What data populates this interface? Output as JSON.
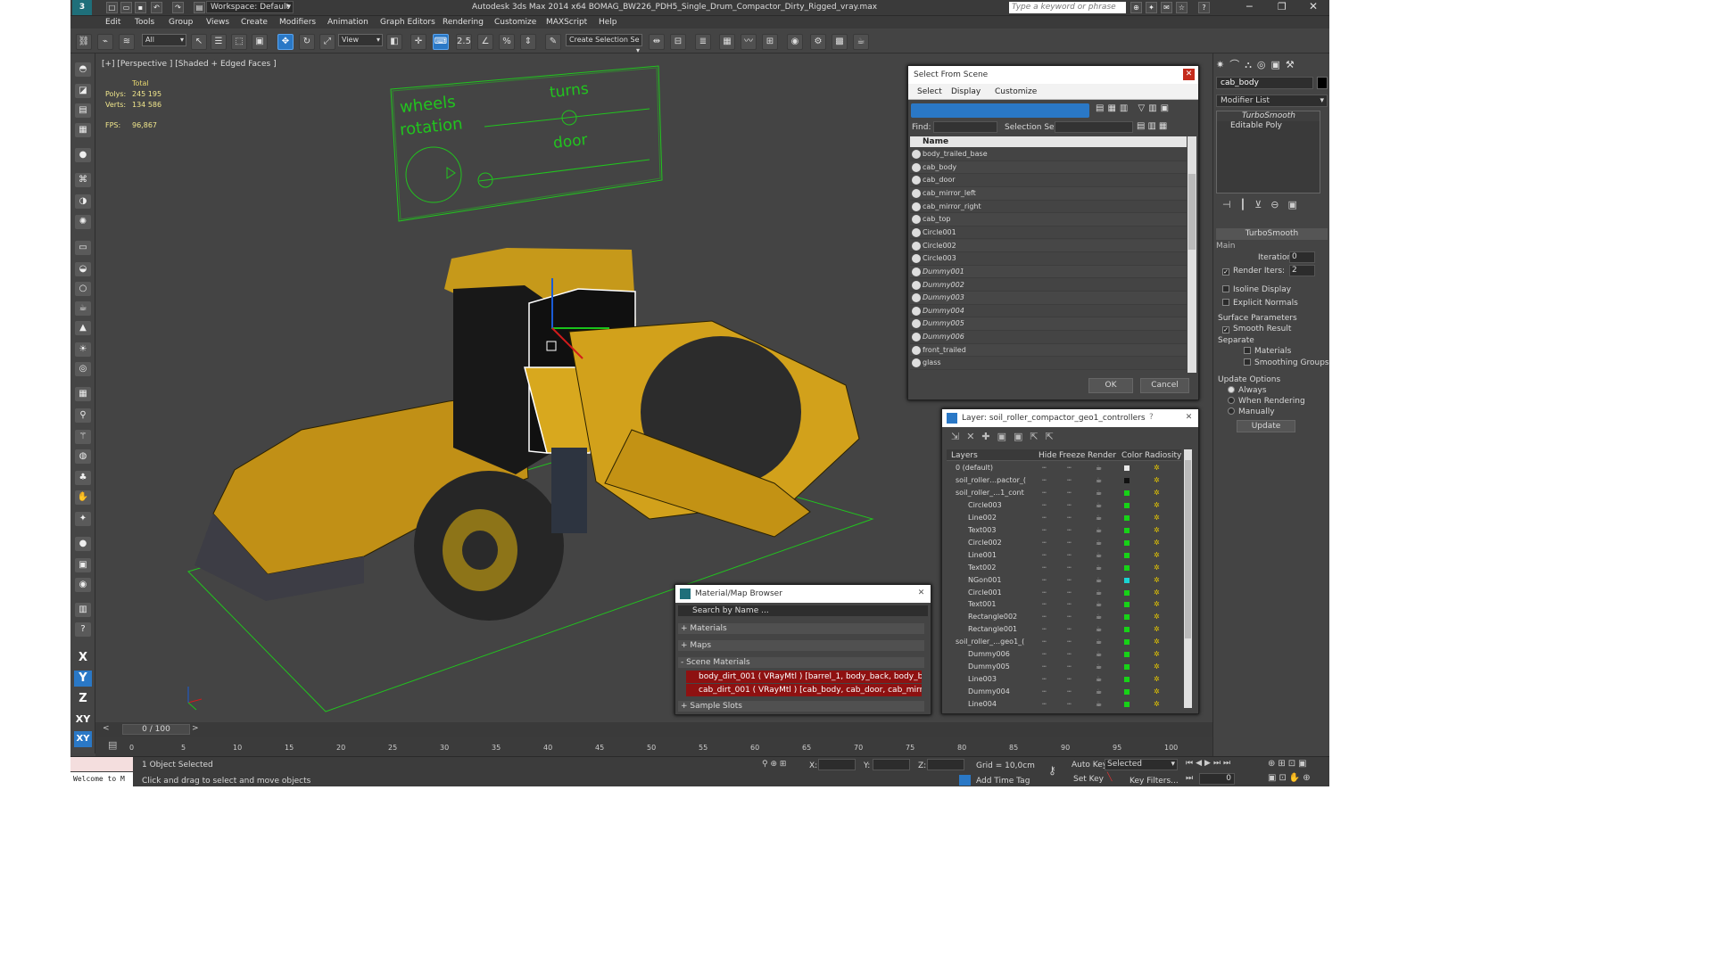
{
  "app": {
    "workspace": "Workspace: Default",
    "title": "Autodesk 3ds Max  2014 x64     BOMAG_BW226_PDH5_Single_Drum_Compactor_Dirty_Rigged_vray.max",
    "search_placeholder": "Type a keyword or phrase"
  },
  "menu": [
    "Edit",
    "Tools",
    "Group",
    "Views",
    "Create",
    "Modifiers",
    "Animation",
    "Graph Editors",
    "Rendering",
    "Customize",
    "MAXScript",
    "Help"
  ],
  "toolbar": {
    "filter": "All",
    "coord": "View",
    "snap_angle": "2.5",
    "snap_pct": "%",
    "selection_set": "Create Selection Se"
  },
  "viewport": {
    "label": "[+] [Perspective ] [Shaded + Edged Faces ]",
    "stats": {
      "total": "Total",
      "polys_label": "Polys:",
      "polys": "245 195",
      "verts_label": "Verts:",
      "verts": "134 586",
      "fps_label": "FPS:",
      "fps": "96,867"
    },
    "control_panel": {
      "wheels": "wheels",
      "rotation": "rotation",
      "turns": "turns",
      "door": "door"
    }
  },
  "select_scene": {
    "title": "Select From Scene",
    "menu": [
      "Select",
      "Display",
      "Customize"
    ],
    "find_label": "Find:",
    "sel_set_label": "Selection Set:",
    "col_name": "Name",
    "items": [
      {
        "name": "body_trailed_base",
        "italic": false
      },
      {
        "name": "cab_body",
        "italic": false
      },
      {
        "name": "cab_door",
        "italic": false
      },
      {
        "name": "cab_mirror_left",
        "italic": false
      },
      {
        "name": "cab_mirror_right",
        "italic": false
      },
      {
        "name": "cab_top",
        "italic": false
      },
      {
        "name": "Circle001",
        "italic": false
      },
      {
        "name": "Circle002",
        "italic": false
      },
      {
        "name": "Circle003",
        "italic": false
      },
      {
        "name": "Dummy001",
        "italic": true
      },
      {
        "name": "Dummy002",
        "italic": true
      },
      {
        "name": "Dummy003",
        "italic": true
      },
      {
        "name": "Dummy004",
        "italic": true
      },
      {
        "name": "Dummy005",
        "italic": true
      },
      {
        "name": "Dummy006",
        "italic": true
      },
      {
        "name": "front_trailed",
        "italic": false
      },
      {
        "name": "glass",
        "italic": false
      }
    ],
    "ok": "OK",
    "cancel": "Cancel"
  },
  "layer": {
    "title": "Layer: soil_roller_compactor_geo1_controllers",
    "help": "?",
    "cols": [
      "Layers",
      "Hide",
      "Freeze",
      "Render",
      "Color",
      "Radiosity"
    ],
    "rows": [
      {
        "name": "0 (default)",
        "indent": 0,
        "color": "#e8e8e8"
      },
      {
        "name": "soil_roller…pactor_(",
        "indent": 0,
        "color": "#111111"
      },
      {
        "name": "soil_roller_…1_cont",
        "indent": 0,
        "color": "#17d317"
      },
      {
        "name": "Circle003",
        "indent": 1,
        "color": "#17d317"
      },
      {
        "name": "Line002",
        "indent": 1,
        "color": "#17d317"
      },
      {
        "name": "Text003",
        "indent": 1,
        "color": "#17d317"
      },
      {
        "name": "Circle002",
        "indent": 1,
        "color": "#17d317"
      },
      {
        "name": "Line001",
        "indent": 1,
        "color": "#17d317"
      },
      {
        "name": "Text002",
        "indent": 1,
        "color": "#17d317"
      },
      {
        "name": "NGon001",
        "indent": 1,
        "color": "#1ad4d4"
      },
      {
        "name": "Circle001",
        "indent": 1,
        "color": "#17d317"
      },
      {
        "name": "Text001",
        "indent": 1,
        "color": "#17d317"
      },
      {
        "name": "Rectangle002",
        "indent": 1,
        "color": "#17d317"
      },
      {
        "name": "Rectangle001",
        "indent": 1,
        "color": "#17d317"
      },
      {
        "name": "soil_roller_…geo1_(",
        "indent": 0,
        "color": "#17d317"
      },
      {
        "name": "Dummy006",
        "indent": 1,
        "color": "#17d317"
      },
      {
        "name": "Dummy005",
        "indent": 1,
        "color": "#17d317"
      },
      {
        "name": "Line003",
        "indent": 1,
        "color": "#17d317"
      },
      {
        "name": "Dummy004",
        "indent": 1,
        "color": "#17d317"
      },
      {
        "name": "Line004",
        "indent": 1,
        "color": "#17d317"
      }
    ]
  },
  "material": {
    "title": "Material/Map Browser",
    "search": "Search by Name ...",
    "sections": [
      "+ Materials",
      "+ Maps",
      "- Scene Materials",
      "+ Sample Slots"
    ],
    "entries": [
      "body_dirt_001  ( VRayMtl )  [barrel_1, body_back, body_back_l...",
      "cab_dirt_001  ( VRayMtl )  [cab_body, cab_door, cab_mirror_lef..."
    ]
  },
  "command": {
    "object_name": "cab_body",
    "modifier_list": "Modifier List",
    "stack": [
      "TurboSmooth",
      "Editable Poly"
    ],
    "rollout": "TurboSmooth",
    "main": "Main",
    "iterations_label": "Iterations:",
    "iterations": "0",
    "render_iters_label": "Render Iters:",
    "render_iters": "2",
    "isoline": "Isoline Display",
    "explicit": "Explicit Normals",
    "surface": "Surface Parameters",
    "smooth_result": "Smooth Result",
    "separate": "Separate",
    "materials": "Materials",
    "smoothing_groups": "Smoothing Groups",
    "update_options": "Update Options",
    "always": "Always",
    "when_rendering": "When Rendering",
    "manually": "Manually",
    "update": "Update"
  },
  "timeline": {
    "frame": "0 / 100",
    "ticks": [
      "0",
      "5",
      "10",
      "15",
      "20",
      "25",
      "30",
      "35",
      "40",
      "45",
      "50",
      "55",
      "60",
      "65",
      "70",
      "75",
      "80",
      "85",
      "90",
      "95",
      "100"
    ]
  },
  "status": {
    "welcome": "Welcome to M",
    "selected": "1 Object Selected",
    "prompt": "Click and drag to select and move objects",
    "x": "X:",
    "y": "Y:",
    "z": "Z:",
    "grid": "Grid = 10,0cm",
    "add_time_tag": "Add Time Tag",
    "auto_key": "Auto Key",
    "set_key": "Set Key",
    "selected_dd": "Selected",
    "key_filters": "Key Filters...",
    "frame_field": "0"
  }
}
